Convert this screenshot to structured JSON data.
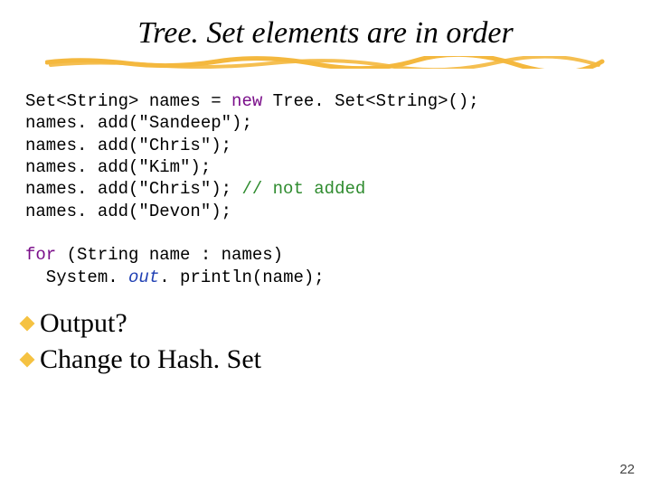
{
  "title": "Tree. Set elements are in order",
  "code": {
    "l1a": "Set<String> names = ",
    "l1kw": "new",
    "l1b": " Tree. Set<String>();",
    "l2": "names. add(\"Sandeep\");",
    "l3": "names. add(\"Chris\");",
    "l4": "names. add(\"Kim\");",
    "l5a": "names. add(\"Chris\"); ",
    "l5c": "// not added",
    "l6": "names. add(\"Devon\");",
    "l7kw": "for",
    "l7a": " (String name : names)",
    "l8a": "  System. ",
    "l8f": "out",
    "l8b": ". println(name);"
  },
  "bullets": {
    "b1": "Output?",
    "b2": "Change to Hash. Set"
  },
  "page": "22"
}
